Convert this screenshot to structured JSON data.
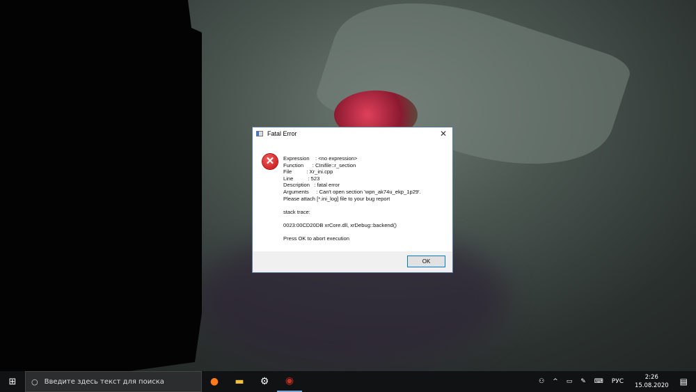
{
  "dialog": {
    "title": "Fatal Error",
    "lines": [
      "Expression    : <no expression>",
      "Function      : CInifile::r_section",
      "File          : Xr_ini.cpp",
      "Line          : 523",
      "Description   : fatal error",
      "Arguments     : Can't open section 'wpn_ak74u_ekp_1p29'.",
      "Please attach [*.ini_log] file to your bug report",
      "",
      "stack trace:",
      "",
      "0023:00CD20DB xrCore.dll, xrDebug::backend()",
      "",
      "Press OK to abort execution"
    ],
    "ok_label": "OK",
    "close_label": "✕"
  },
  "taskbar": {
    "search_placeholder": "Введите здесь текст для поиска",
    "language": "РУС",
    "time": "2:26",
    "date": "15.08.2020",
    "pinned": [
      "firefox-icon",
      "file-explorer-icon",
      "settings-icon",
      "game-icon"
    ]
  }
}
